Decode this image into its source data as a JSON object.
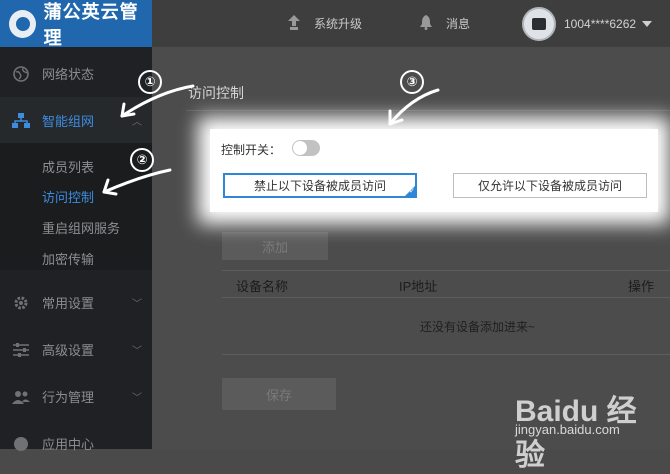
{
  "app": {
    "title": "蒲公英云管理"
  },
  "topbar": {
    "system_upgrade": "系统升级",
    "messages": "消息",
    "account": "1004****6262"
  },
  "sidebar": {
    "items": [
      {
        "label": "网络状态",
        "icon": "globe-icon"
      },
      {
        "label": "智能组网",
        "icon": "network-icon",
        "active": true
      },
      {
        "label": "常用设置",
        "icon": "gear-icon"
      },
      {
        "label": "高级设置",
        "icon": "sliders-icon"
      },
      {
        "label": "行为管理",
        "icon": "users-icon"
      },
      {
        "label": "应用中心",
        "icon": "apps-icon"
      }
    ],
    "submenu": [
      {
        "label": "成员列表"
      },
      {
        "label": "访问控制",
        "active": true
      },
      {
        "label": "重启组网服务"
      },
      {
        "label": "加密传输"
      }
    ]
  },
  "page": {
    "title": "访问控制",
    "control_switch_label": "控制开关：",
    "switch_on": false,
    "option_deny": "禁止以下设备被成员访问",
    "option_allow": "仅允许以下设备被成员访问",
    "add_button": "添加",
    "table": {
      "headers": [
        "设备名称",
        "IP地址",
        "操作"
      ],
      "empty_text": "还没有设备添加进来~"
    },
    "save_button": "保存"
  },
  "annotations": [
    "①",
    "②",
    "③"
  ],
  "watermark": {
    "brand": "Baidu 经验",
    "url": "jingyan.baidu.com"
  },
  "colors": {
    "accent": "#2067ad",
    "active_text": "#3d8ce0",
    "selected_border": "#2f86d6"
  }
}
